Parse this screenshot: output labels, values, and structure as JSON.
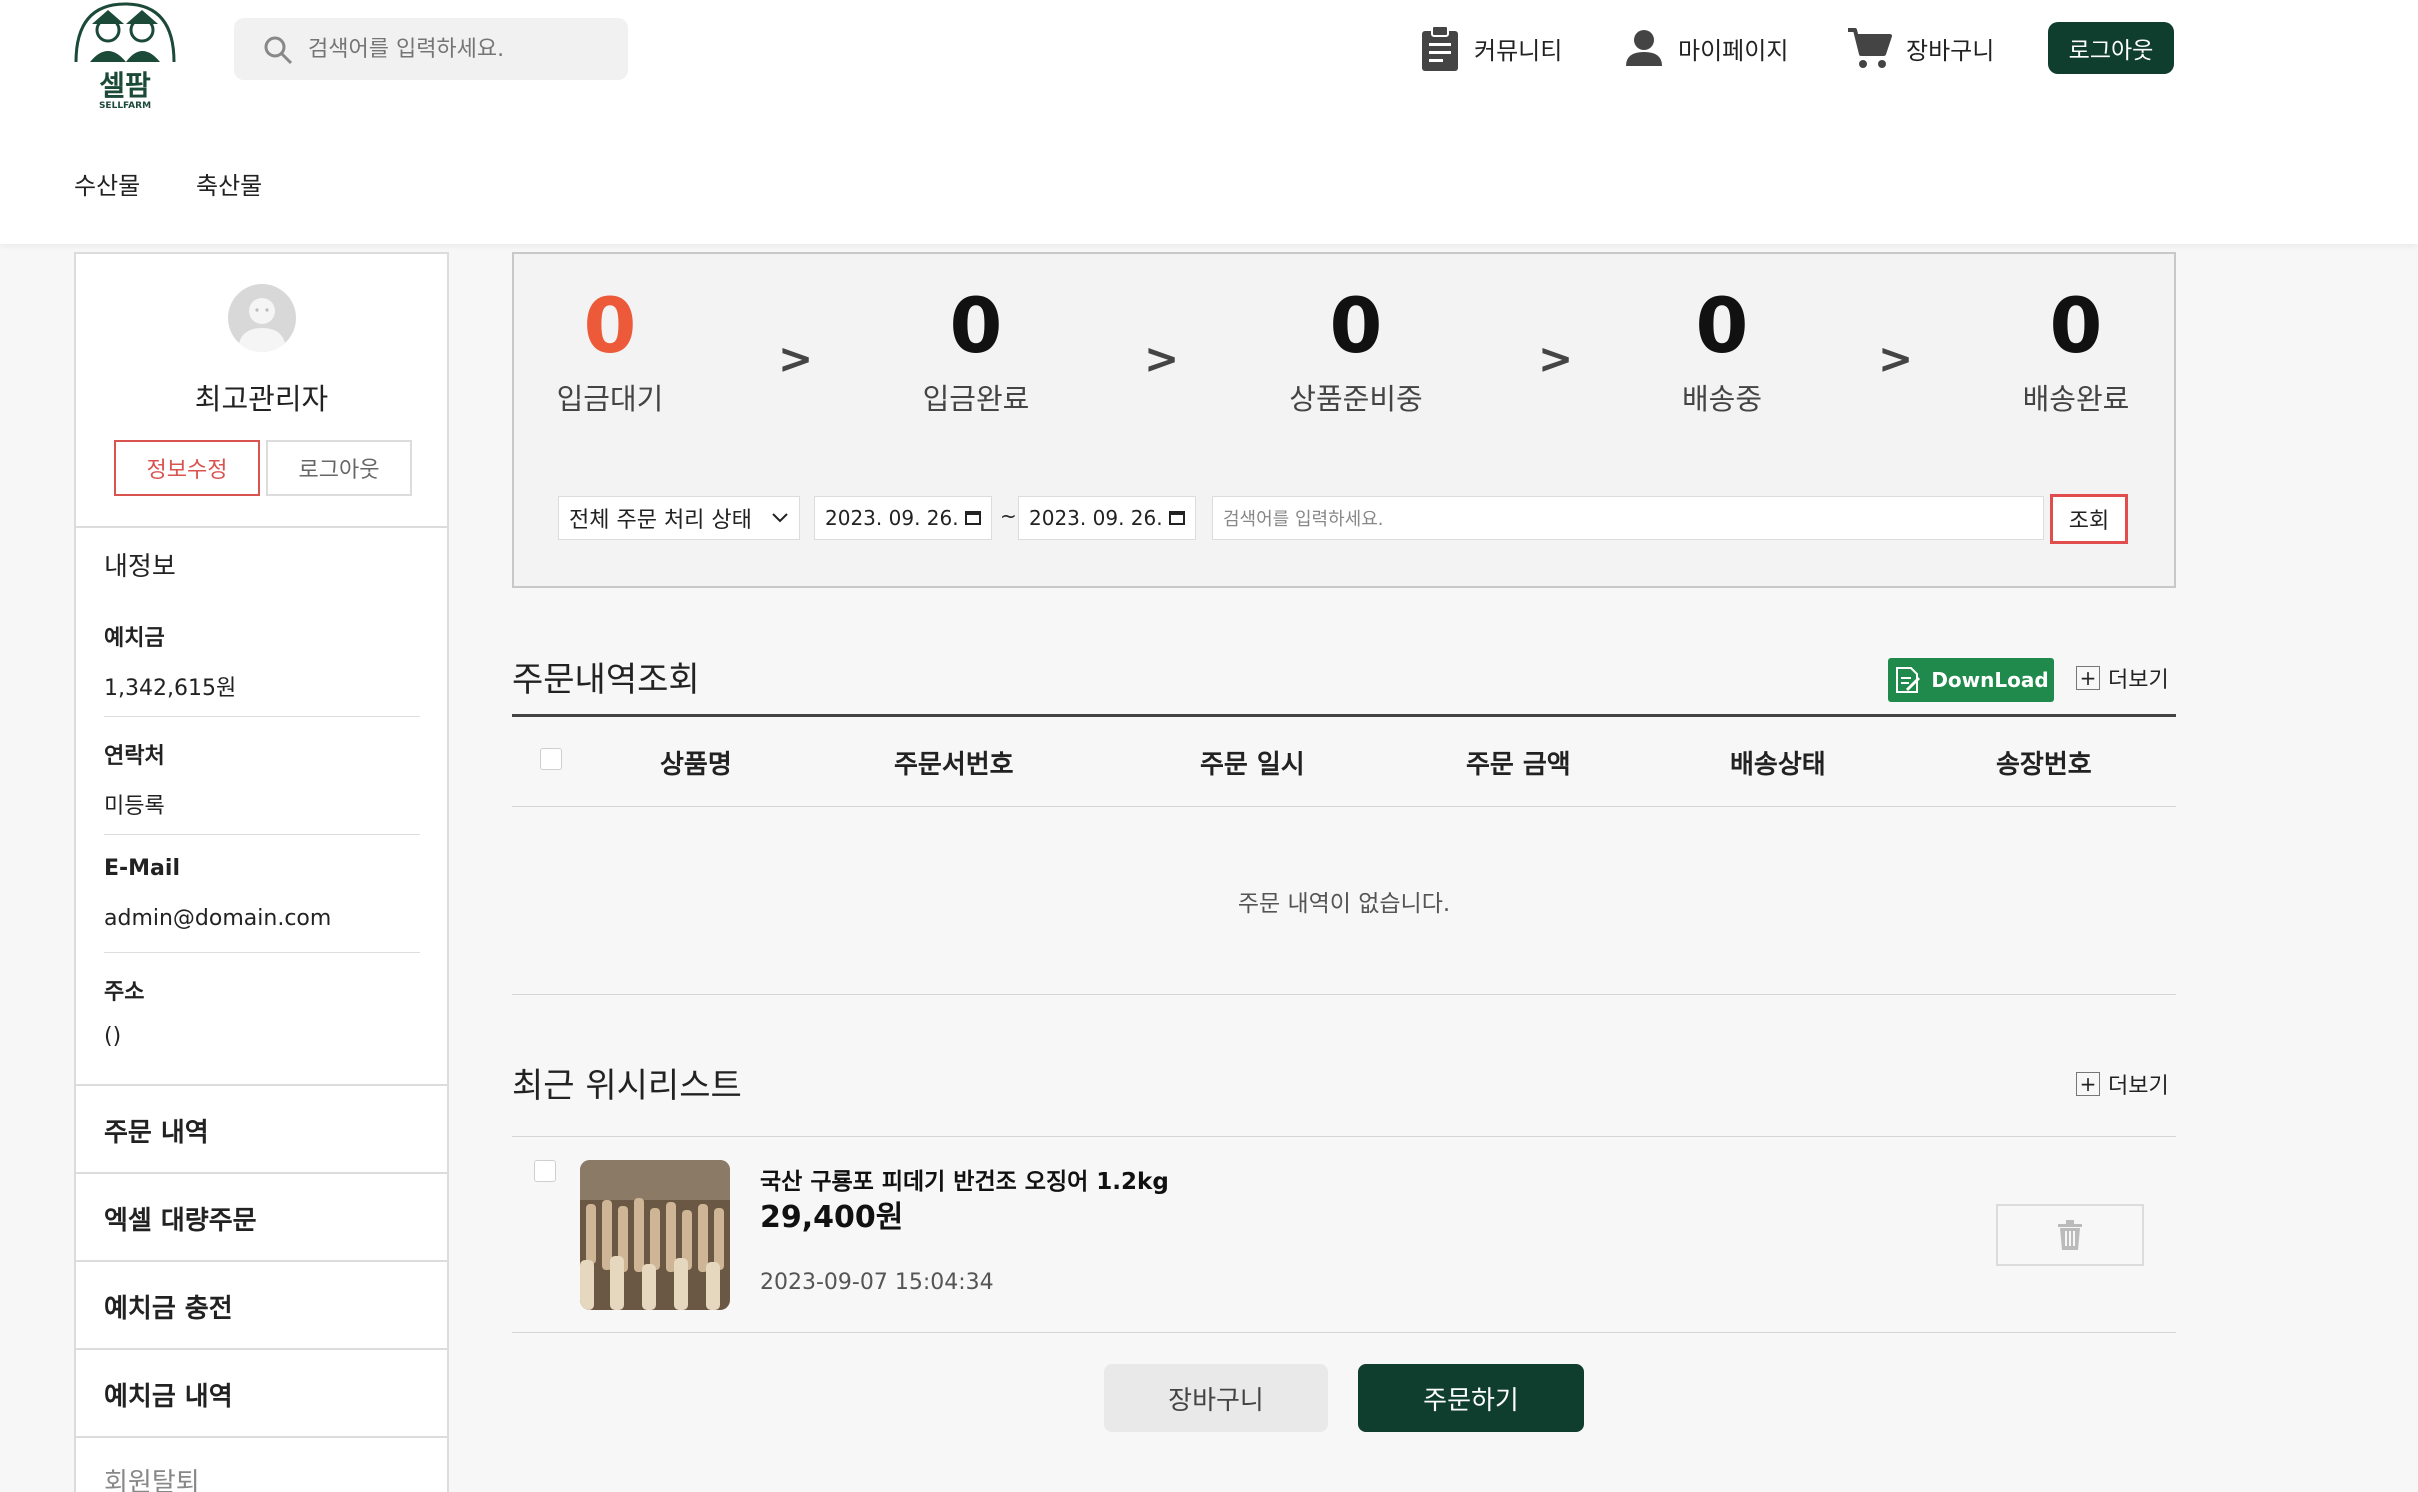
{
  "header": {
    "logo_text": "셀팜",
    "logo_subtext": "SELLFARM",
    "search_placeholder": "검색어를 입력하세요.",
    "nav": [
      {
        "label": "커뮤니티",
        "icon": "clipboard-icon"
      },
      {
        "label": "마이페이지",
        "icon": "user-icon"
      },
      {
        "label": "장바구니",
        "icon": "cart-icon"
      }
    ],
    "logout_label": "로그아웃",
    "categories": [
      "수산물",
      "축산물"
    ]
  },
  "sidebar": {
    "name": "최고관리자",
    "edit_label": "정보수정",
    "logout_label": "로그아웃",
    "section_title": "내정보",
    "fields": [
      {
        "label": "예치금",
        "value": "1,342,615원"
      },
      {
        "label": "연락처",
        "value": "미등록"
      },
      {
        "label": "E-Mail",
        "value": "admin@domain.com"
      },
      {
        "label": "주소",
        "value": "()"
      }
    ],
    "menu": [
      "주문 내역",
      "엑셀 대량주문",
      "예치금 충전",
      "예치금 내역"
    ],
    "withdraw_label": "회원탈퇴"
  },
  "status": {
    "items": [
      {
        "count": "0",
        "label": "입금대기"
      },
      {
        "count": "0",
        "label": "입금완료"
      },
      {
        "count": "0",
        "label": "상품준비중"
      },
      {
        "count": "0",
        "label": "배송중"
      },
      {
        "count": "0",
        "label": "배송완료"
      }
    ],
    "arrow": ">",
    "accent_color": "#ec5a3a"
  },
  "filter": {
    "status_select": "전체 주문 처리 상태",
    "date_start": "2023. 09. 26.",
    "date_end": "2023. 09. 26.",
    "date_separator": "~",
    "search_placeholder": "검색어를 입력하세요.",
    "lookup_label": "조회"
  },
  "orders": {
    "title": "주문내역조회",
    "download_label": "DownLoad",
    "more_label": "더보기",
    "columns": [
      "상품명",
      "주문서번호",
      "주문 일시",
      "주문 금액",
      "배송상태",
      "송장번호"
    ],
    "empty_message": "주문 내역이 없습니다."
  },
  "wishlist": {
    "title": "최근 위시리스트",
    "more_label": "더보기",
    "items": [
      {
        "name": "국산 구룡포 피데기 반건조 오징어 1.2kg",
        "price": "29,400원",
        "date": "2023-09-07 15:04:34"
      }
    ]
  },
  "actions": {
    "cart_label": "장바구니",
    "order_label": "주문하기"
  },
  "colors": {
    "brand": "#0f3d2e",
    "download": "#1f8a4c",
    "highlight": "#e14c4c"
  }
}
